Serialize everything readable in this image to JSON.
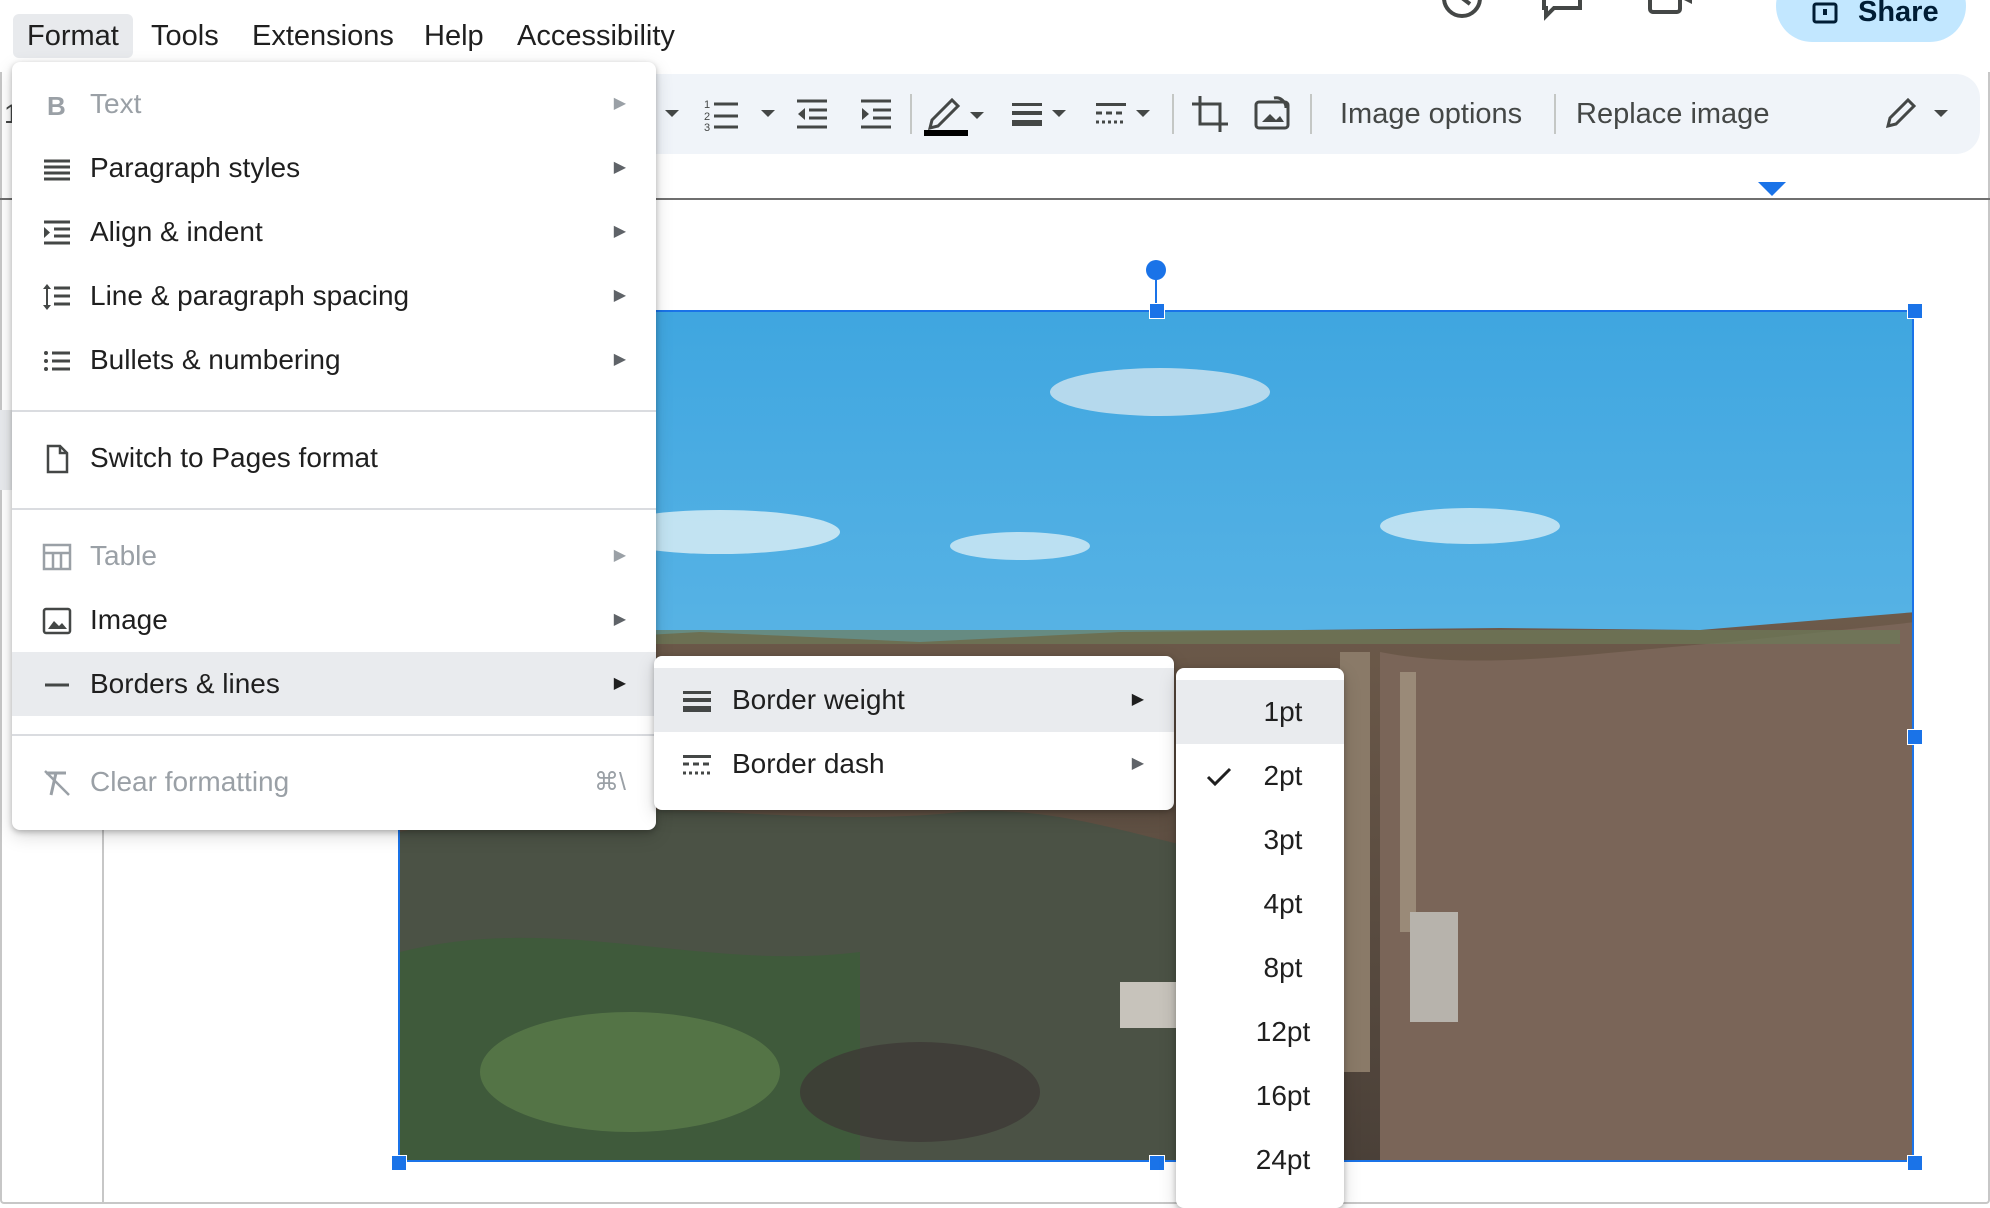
{
  "menubar": {
    "items": [
      "Format",
      "Tools",
      "Extensions",
      "Help",
      "Accessibility"
    ],
    "share_label": "Share"
  },
  "toolbar": {
    "image_options": "Image options",
    "replace_image": "Replace image",
    "left_cut_text": "1"
  },
  "format_menu": {
    "items": [
      {
        "label": "Text",
        "icon": "bold-icon",
        "disabled": true,
        "submenu": true
      },
      {
        "label": "Paragraph styles",
        "icon": "paragraph-styles-icon",
        "disabled": false,
        "submenu": true
      },
      {
        "label": "Align & indent",
        "icon": "align-indent-icon",
        "disabled": false,
        "submenu": true
      },
      {
        "label": "Line & paragraph spacing",
        "icon": "line-spacing-icon",
        "disabled": false,
        "submenu": true
      },
      {
        "label": "Bullets & numbering",
        "icon": "bulleted-list-icon",
        "disabled": false,
        "submenu": true
      },
      {
        "label": "Switch to Pages format",
        "icon": "document-icon",
        "disabled": false,
        "submenu": false
      },
      {
        "label": "Table",
        "icon": "table-icon",
        "disabled": true,
        "submenu": true
      },
      {
        "label": "Image",
        "icon": "image-icon",
        "disabled": false,
        "submenu": true
      },
      {
        "label": "Borders & lines",
        "icon": "horizontal-line-icon",
        "disabled": false,
        "submenu": true,
        "highlighted": true
      },
      {
        "label": "Clear formatting",
        "icon": "clear-formatting-icon",
        "disabled": true,
        "submenu": false,
        "shortcut": "⌘\\"
      }
    ]
  },
  "borders_submenu": {
    "items": [
      {
        "label": "Border weight",
        "icon": "border-weight-icon",
        "highlighted": true
      },
      {
        "label": "Border dash",
        "icon": "border-dash-icon",
        "highlighted": false
      }
    ]
  },
  "weight_submenu": {
    "items": [
      "1pt",
      "2pt",
      "3pt",
      "4pt",
      "8pt",
      "12pt",
      "16pt",
      "24pt"
    ],
    "selected": "2pt",
    "hovered": "1pt"
  },
  "colors": {
    "accent": "#1a73e8",
    "share_bg": "#c2e7ff",
    "toolbar_bg": "#f0f4f9",
    "menu_highlight": "#e9ebee"
  }
}
